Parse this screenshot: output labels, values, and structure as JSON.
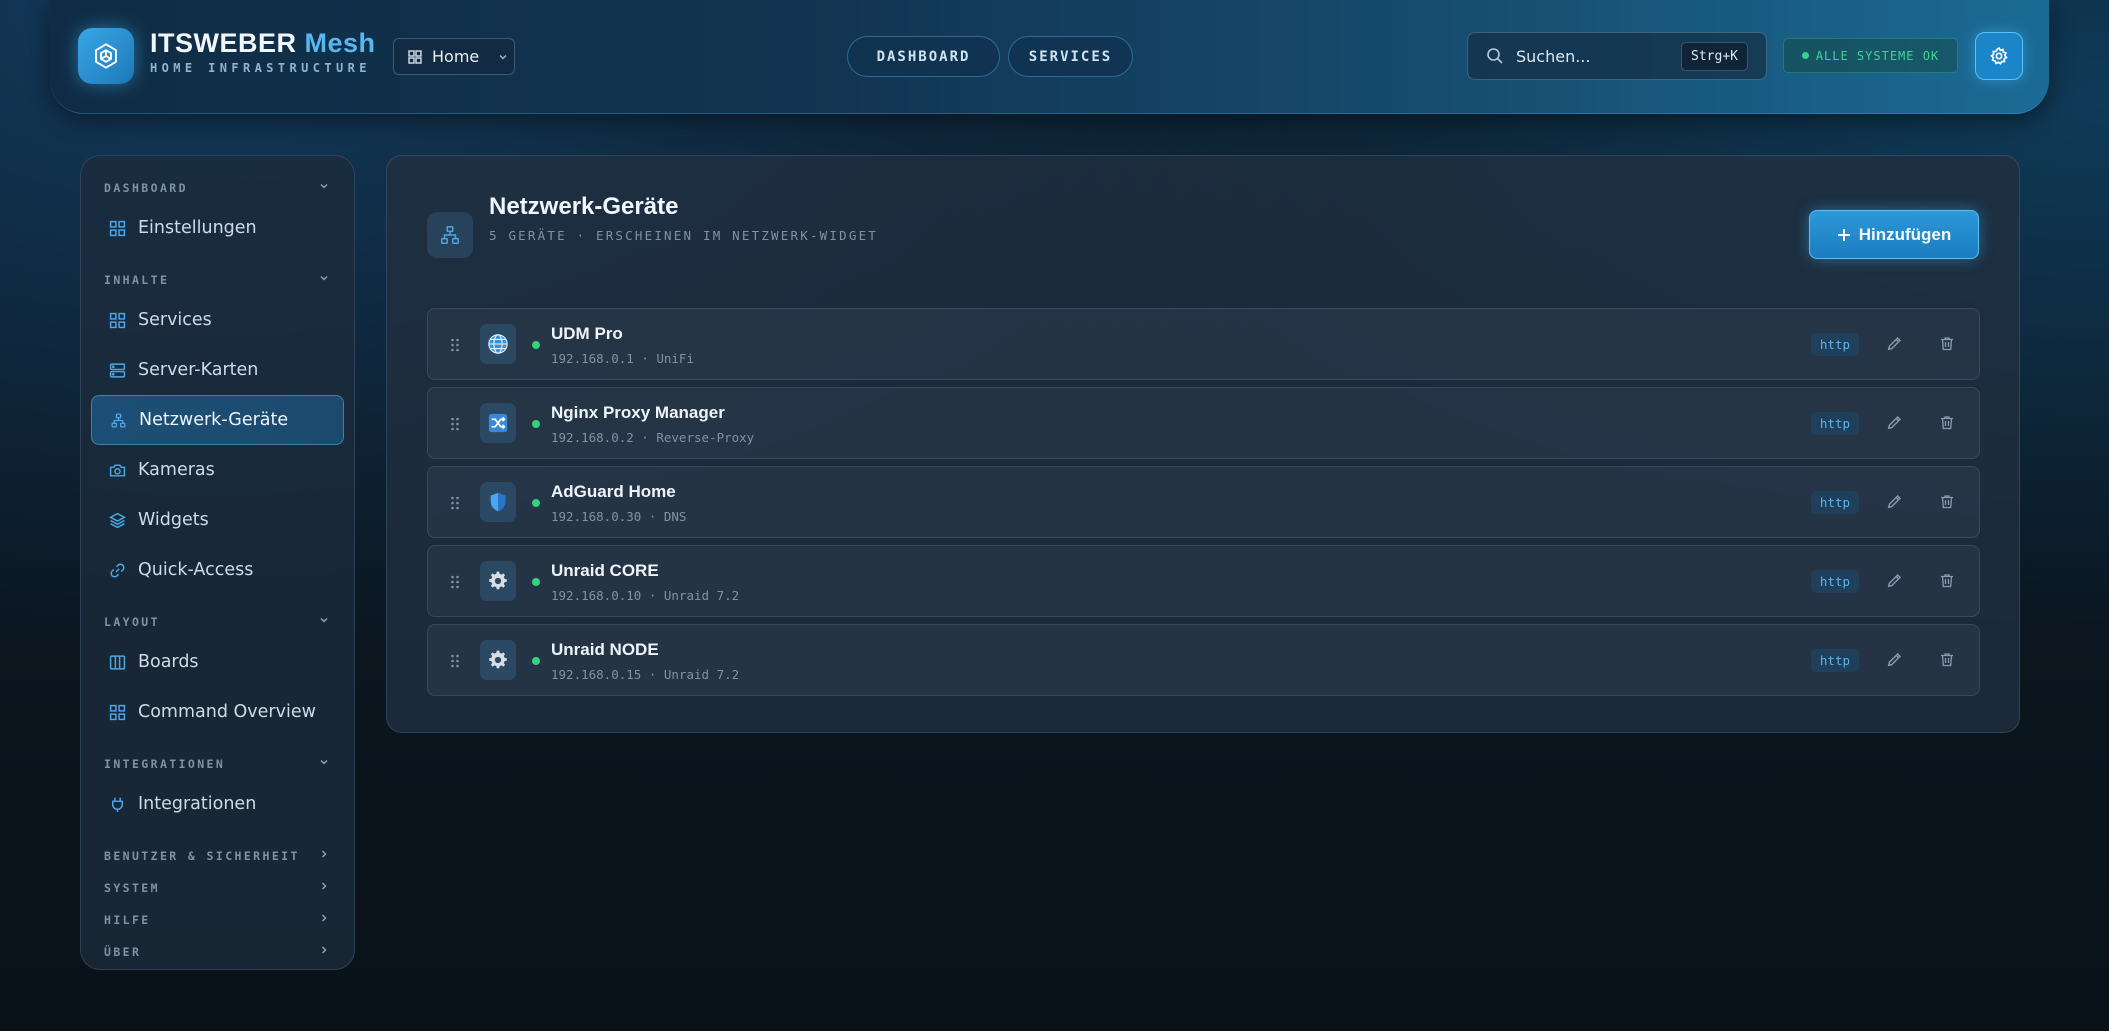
{
  "header": {
    "brand_main": "ITSWEBER",
    "brand_accent": "Mesh",
    "brand_subtitle": "HOME INFRASTRUCTURE",
    "board_select": "Home",
    "nav": [
      "DASHBOARD",
      "SERVICES"
    ],
    "search_placeholder": "Suchen...",
    "search_shortcut": "Strg+K",
    "status": "ALLE SYSTEME OK"
  },
  "sidebar": {
    "sections": [
      {
        "title": "DASHBOARD",
        "expanded": true,
        "items": [
          {
            "label": "Einstellungen",
            "icon": "grid-icon"
          }
        ]
      },
      {
        "title": "INHALTE",
        "expanded": true,
        "items": [
          {
            "label": "Services",
            "icon": "grid-icon"
          },
          {
            "label": "Server-Karten",
            "icon": "server-icon"
          },
          {
            "label": "Netzwerk-Geräte",
            "icon": "network-icon",
            "active": true
          },
          {
            "label": "Kameras",
            "icon": "camera-icon"
          },
          {
            "label": "Widgets",
            "icon": "layers-icon"
          },
          {
            "label": "Quick-Access",
            "icon": "link-icon"
          }
        ]
      },
      {
        "title": "LAYOUT",
        "expanded": true,
        "items": [
          {
            "label": "Boards",
            "icon": "columns-icon"
          },
          {
            "label": "Command Overview",
            "icon": "grid-icon"
          }
        ]
      },
      {
        "title": "INTEGRATIONEN",
        "expanded": true,
        "items": [
          {
            "label": "Integrationen",
            "icon": "plug-icon"
          }
        ]
      },
      {
        "title": "BENUTZER & SICHERHEIT",
        "expanded": false,
        "items": []
      },
      {
        "title": "SYSTEM",
        "expanded": false,
        "items": []
      },
      {
        "title": "HILFE",
        "expanded": false,
        "items": []
      },
      {
        "title": "ÜBER",
        "expanded": false,
        "items": []
      }
    ]
  },
  "main": {
    "title": "Netzwerk-Geräte",
    "subtitle": "5 GERÄTE · ERSCHEINEN IM NETZWERK-WIDGET",
    "add_label": "Hinzufügen",
    "devices": [
      {
        "name": "UDM Pro",
        "meta": "192.168.0.1 · UniFi",
        "protocol": "http",
        "icon": "globe-icon",
        "online": true
      },
      {
        "name": "Nginx Proxy Manager",
        "meta": "192.168.0.2 · Reverse-Proxy",
        "protocol": "http",
        "icon": "shuffle-icon",
        "online": true
      },
      {
        "name": "AdGuard Home",
        "meta": "192.168.0.30 · DNS",
        "protocol": "http",
        "icon": "shield-icon",
        "online": true
      },
      {
        "name": "Unraid CORE",
        "meta": "192.168.0.10 · Unraid 7.2",
        "protocol": "http",
        "icon": "cog-icon",
        "online": true
      },
      {
        "name": "Unraid NODE",
        "meta": "192.168.0.15 · Unraid 7.2",
        "protocol": "http",
        "icon": "cog-icon",
        "online": true
      }
    ]
  },
  "colors": {
    "accent": "#2c98d8",
    "online": "#34d17f",
    "status_ok": "#41d38f"
  }
}
